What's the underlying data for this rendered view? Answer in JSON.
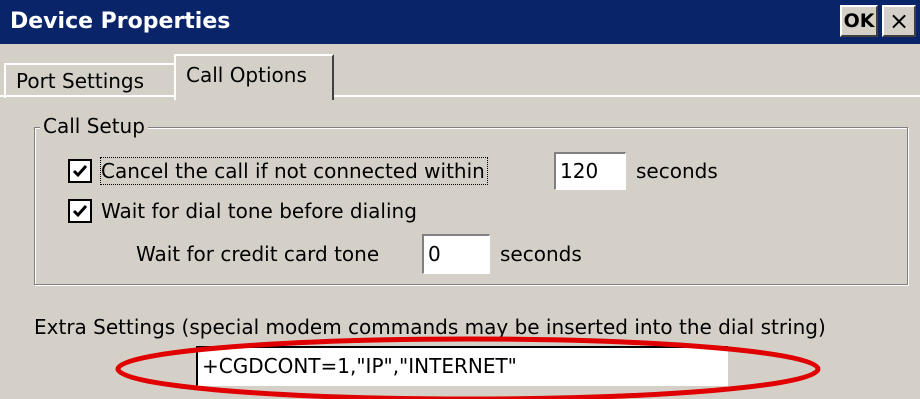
{
  "window": {
    "title": "Device Properties",
    "ok_label": "OK",
    "close_label": "×"
  },
  "tabs": [
    {
      "label": "Port Settings",
      "selected": false
    },
    {
      "label": "Call Options",
      "selected": true
    }
  ],
  "call_setup": {
    "group_label": "Call Setup",
    "cancel_call": {
      "checked": true,
      "label": "Cancel the call if not connected within",
      "mnemonic": "C",
      "value": "120",
      "unit": "seconds"
    },
    "wait_dial_tone": {
      "checked": true,
      "label": "Wait for dial tone before dialing",
      "mnemonic": "W"
    },
    "credit_card_tone": {
      "label": "Wait for credit card tone",
      "mnemonic": "t",
      "value": "0",
      "unit": "seconds"
    }
  },
  "extra_settings": {
    "label": "Extra Settings (special modem commands may be inserted into the dial string)",
    "mnemonic": "x",
    "value": "+CGDCONT=1,\"IP\",\"INTERNET\""
  },
  "colors": {
    "titlebar": "#0a246a",
    "face": "#d4d0c8",
    "annotation_ellipse": "#e00000"
  }
}
